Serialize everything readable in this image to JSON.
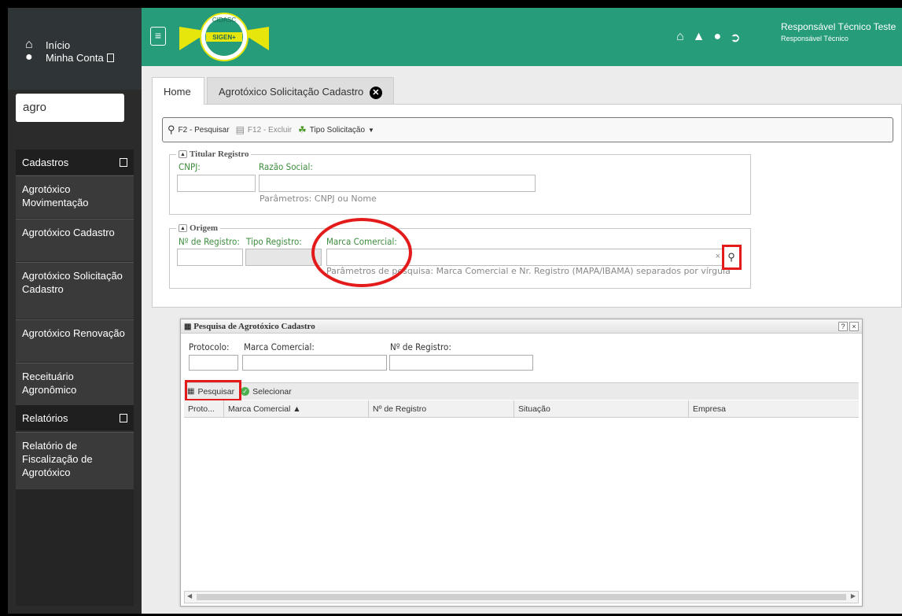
{
  "sidebar": {
    "inicio": "Início",
    "minha_conta": "Minha Conta",
    "search_value": "agro",
    "sections": [
      {
        "label": "Cadastros"
      },
      {
        "label": "Relatórios"
      }
    ],
    "items": [
      {
        "label": "Agrotóxico Movimentação"
      },
      {
        "label": "Agrotóxico Cadastro"
      },
      {
        "label": "Agrotóxico Solicitação Cadastro"
      },
      {
        "label": "Agrotóxico Renovação"
      },
      {
        "label": "Receituário Agronômico"
      },
      {
        "label": "Relatório de Fiscalização de Agrotóxico"
      }
    ]
  },
  "header": {
    "logo_top": "CIDASC",
    "logo_main": "SIGEN+",
    "user_name": "Responsável Técnico Teste",
    "user_role": "Responsável Técnico",
    "colors": {
      "accent": "#269c7a"
    }
  },
  "tabs": [
    {
      "label": "Home"
    },
    {
      "label": "Agrotóxico Solicitação Cadastro"
    }
  ],
  "toolbar": {
    "pesquisar": "F2 - Pesquisar",
    "excluir": "F12 - Excluir",
    "tipo": "Tipo Solicitação"
  },
  "titular": {
    "legend": "Titular Registro",
    "cnpj_label": "CNPJ:",
    "razao_label": "Razão Social:",
    "hint": "Parâmetros: CNPJ ou Nome"
  },
  "origem": {
    "legend": "Origem",
    "registro_label": "Nº de Registro:",
    "tipo_label": "Tipo Registro:",
    "marca_label": "Marca Comercial:",
    "hint": "Parâmetros de pesquisa: Marca Comercial e Nr. Registro (MAPA/IBAMA) separados por vírgula"
  },
  "modal": {
    "title": "Pesquisa de Agrotóxico Cadastro",
    "protocolo_label": "Protocolo:",
    "marca_label": "Marca Comercial:",
    "registro_label": "Nº de Registro:",
    "pesquisar_btn": "Pesquisar",
    "selecionar_btn": "Selecionar",
    "columns": [
      "Proto...",
      "Marca Comercial ▲",
      "Nº de Registro",
      "Situação",
      "Empresa"
    ]
  }
}
